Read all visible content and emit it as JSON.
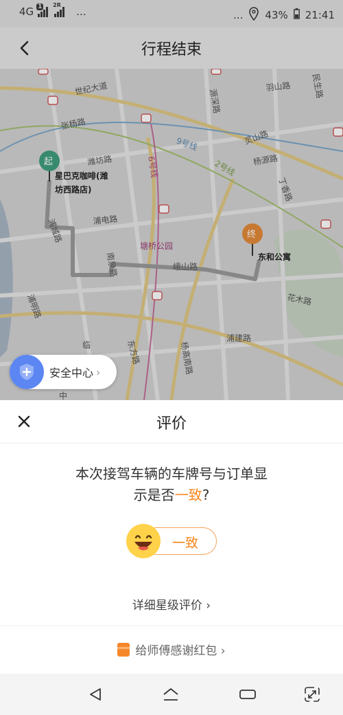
{
  "status_bar": {
    "network": "4G",
    "sim1_badge": "1",
    "sim2_label": "2R",
    "left_more": "...",
    "right_more": "...",
    "battery": "43%",
    "time": "21:41"
  },
  "header": {
    "title": "行程结束"
  },
  "map": {
    "start_badge": "起",
    "start_name_line1": "星巴克咖啡(潍",
    "start_name_line2": "坊西路店)",
    "end_badge": "终",
    "end_name": "东和公寓",
    "park": "塘桥公园",
    "metro_line_6": "6号线",
    "metro_line_9": "9号线",
    "metro_line_2": "2号线",
    "streets": [
      "世纪大道",
      "张杨路",
      "潍坊路",
      "浦城路",
      "浦电路",
      "南泉路",
      "峨山路",
      "源深路",
      "羽山路",
      "灵山路",
      "杨源路",
      "民生路",
      "丁香路",
      "花木路",
      "浦建路",
      "浦明路",
      "东方路",
      "杨高南路",
      "临",
      "中"
    ],
    "start_color": "#3f9e7e",
    "end_color": "#e38a3a"
  },
  "safety": {
    "label": "安全中心"
  },
  "rating": {
    "title": "评价",
    "question_line1": "本次接驾车辆的车牌号与订单显",
    "question_line2_prefix": "示是否",
    "question_highlight": "一致",
    "question_suffix": "?",
    "consistent_button": "一致",
    "detail_link": "详细星级评价 ›",
    "red_packet_link": "给师傅感谢红包 ›",
    "accent_color": "#f5871f"
  }
}
